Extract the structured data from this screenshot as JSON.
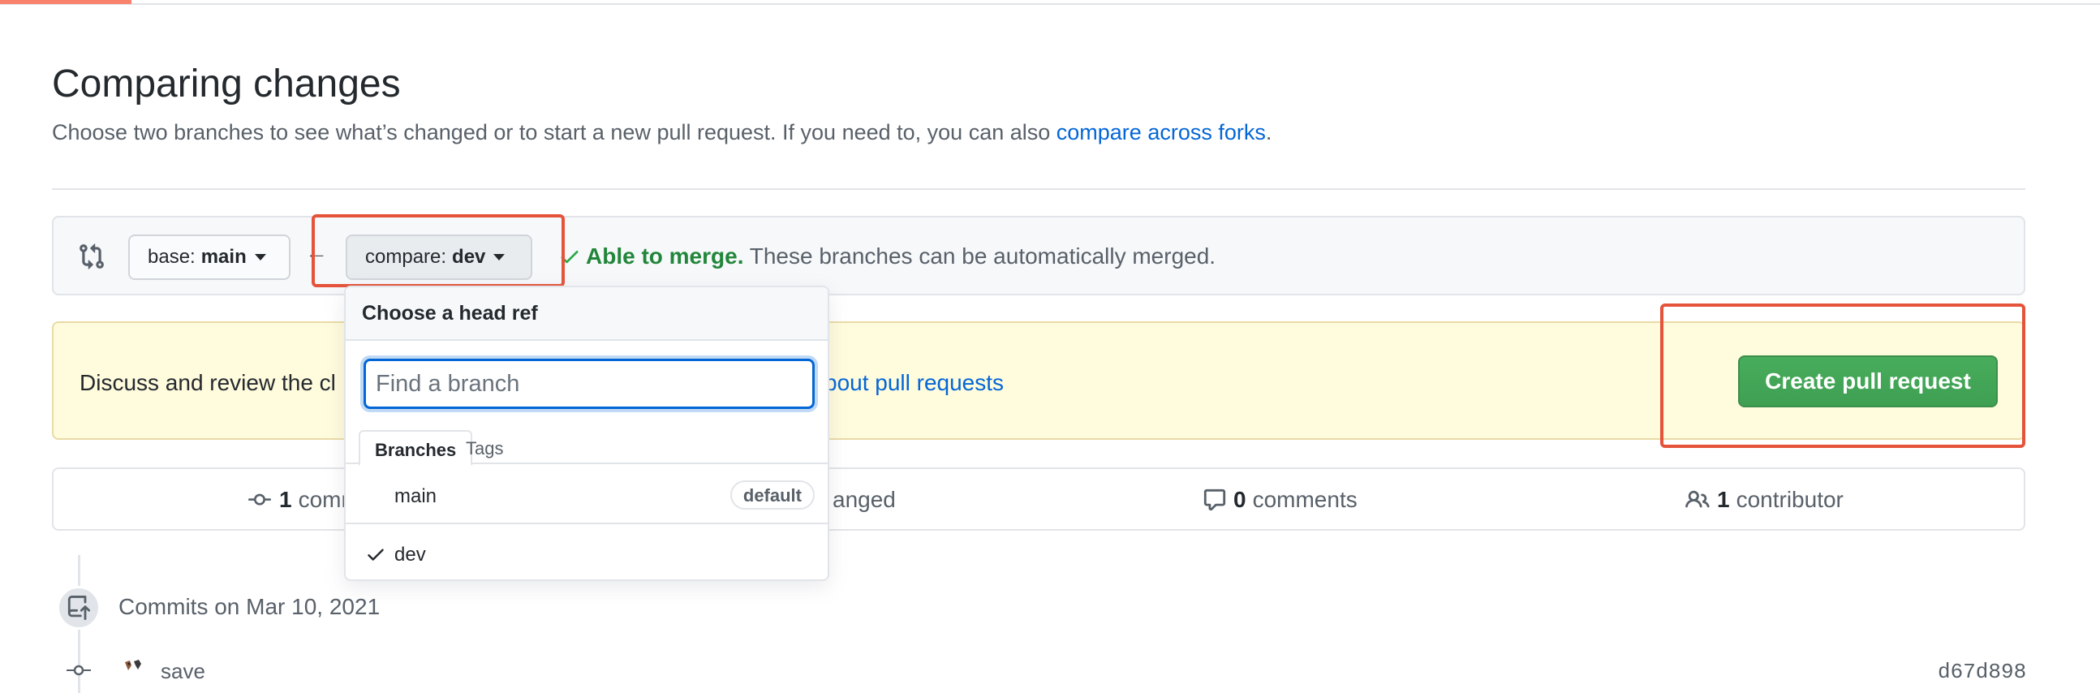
{
  "page": {
    "title": "Comparing changes",
    "subtitle_prefix": "Choose two branches to see what’s changed or to start a new pull request. If you need to, you can also ",
    "subtitle_link": "compare across forks",
    "subtitle_suffix": "."
  },
  "range": {
    "icon": "git-compare-icon",
    "base_label": "base:",
    "base_value": "main",
    "compare_label": "compare:",
    "compare_value": "dev",
    "arrow": "←",
    "merge_status": "Able to merge.",
    "merge_detail": " These branches can be automatically merged."
  },
  "flash": {
    "text": "Discuss and review the cl",
    "link": "bout pull requests",
    "create_button": "Create pull request"
  },
  "stats": {
    "commits_count": "1",
    "commits_label": "comm",
    "files_label": "anged",
    "comments_count": "0",
    "comments_label": "comments",
    "contributors_count": "1",
    "contributors_label": "contributor"
  },
  "timeline": {
    "date": "Commits on Mar 10, 2021",
    "commit_message": "save",
    "commit_sha": "d67d898"
  },
  "dropdown": {
    "header": "Choose a head ref",
    "filter_placeholder": "Find a branch",
    "tabs": [
      "Branches",
      "Tags"
    ],
    "refs": [
      {
        "name": "main",
        "badge": "default",
        "selected": false
      },
      {
        "name": "dev",
        "badge": "",
        "selected": true
      }
    ]
  },
  "colors": {
    "link": "#0366d6",
    "merge_ok": "#22863a",
    "create_button": "#2ea44f",
    "highlight": "#e5533a",
    "flash_bg": "#fffbdd"
  }
}
